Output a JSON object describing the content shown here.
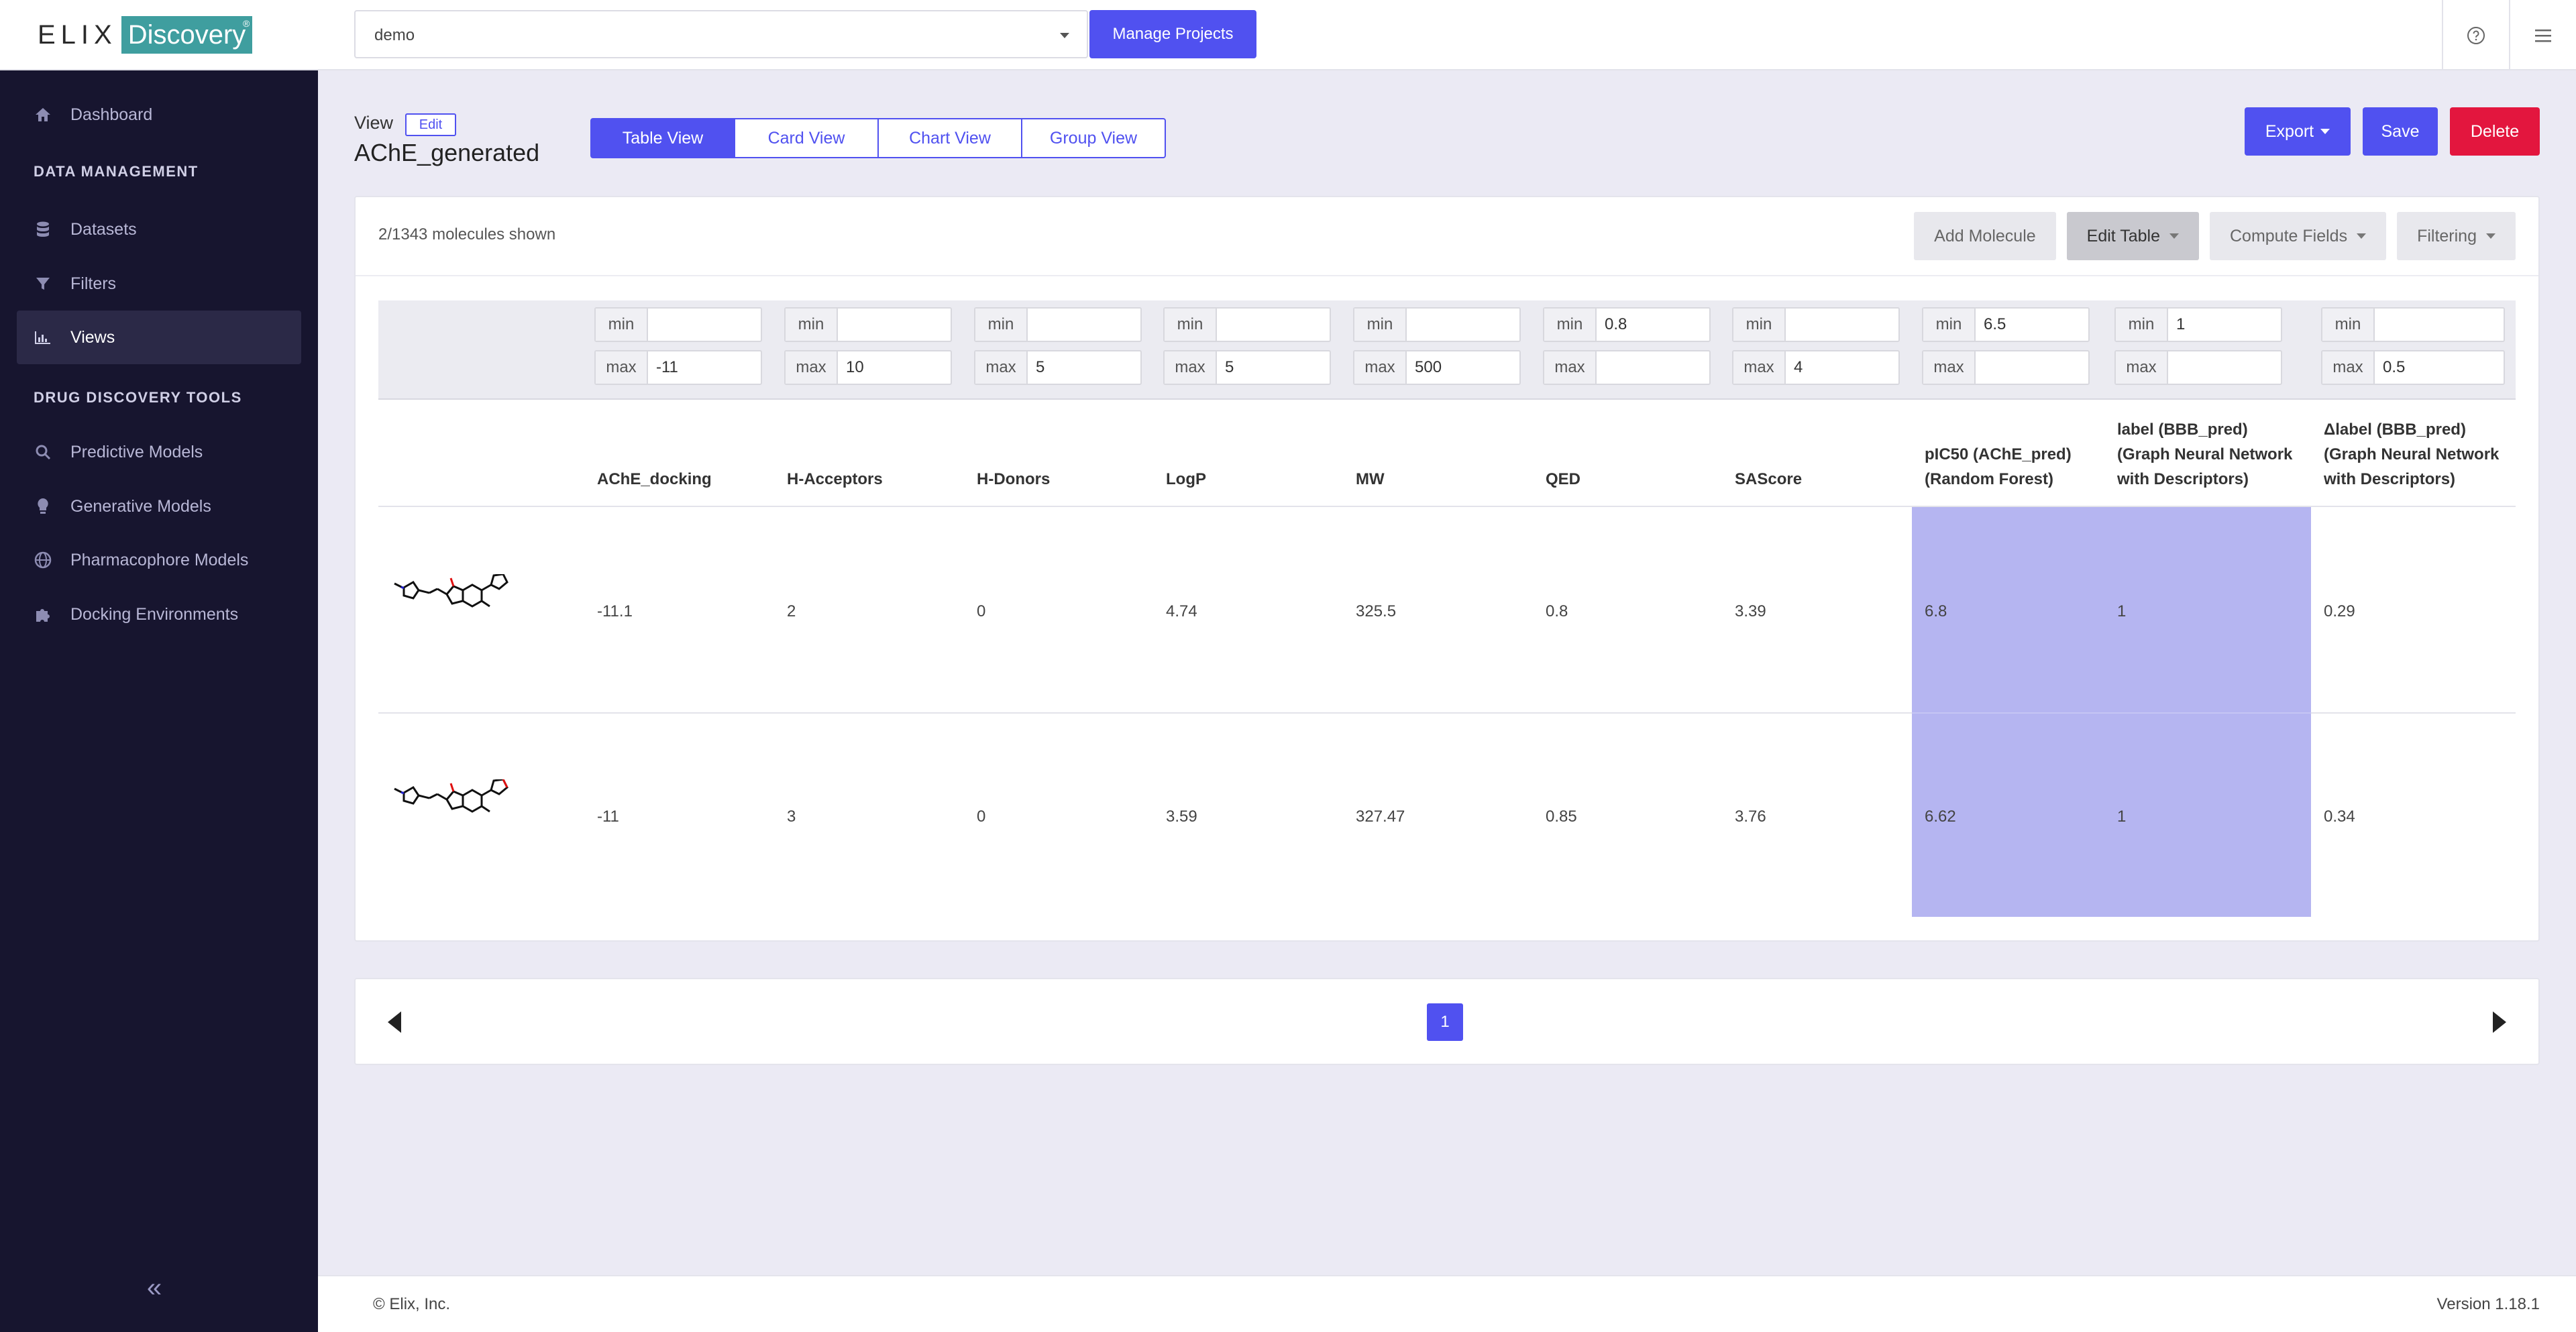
{
  "brand": {
    "part1": "ELIX",
    "part2": "Discovery",
    "mark": "®"
  },
  "project": {
    "selected": "demo",
    "manage_label": "Manage Projects"
  },
  "sidebar": {
    "items": [
      {
        "label": "Dashboard",
        "icon": "home-icon"
      },
      {
        "label": "Datasets",
        "icon": "database-icon"
      },
      {
        "label": "Filters",
        "icon": "filter-icon"
      },
      {
        "label": "Views",
        "icon": "chart-icon"
      },
      {
        "label": "Predictive Models",
        "icon": "search-icon"
      },
      {
        "label": "Generative Models",
        "icon": "lightbulb-icon"
      },
      {
        "label": "Pharmacophore Models",
        "icon": "globe-icon"
      },
      {
        "label": "Docking Environments",
        "icon": "puzzle-icon"
      }
    ],
    "headings": [
      "DATA MANAGEMENT",
      "DRUG DISCOVERY TOOLS"
    ],
    "collapse_label": "«"
  },
  "view": {
    "label": "View",
    "edit_label": "Edit",
    "title": "AChE_generated"
  },
  "tabs": [
    "Table View",
    "Card View",
    "Chart View",
    "Group View"
  ],
  "actions": {
    "export": "Export",
    "save": "Save",
    "delete": "Delete"
  },
  "table_header": {
    "count": "2/1343 molecules shown",
    "buttons": [
      "Add Molecule",
      "Edit Table",
      "Compute Fields",
      "Filtering"
    ]
  },
  "filters": {
    "min_label": "min",
    "max_label": "max",
    "columns": [
      {
        "min": "",
        "max": "-11"
      },
      {
        "min": "",
        "max": "10"
      },
      {
        "min": "",
        "max": "5"
      },
      {
        "min": "",
        "max": "5"
      },
      {
        "min": "",
        "max": "500"
      },
      {
        "min": "0.8",
        "max": ""
      },
      {
        "min": "",
        "max": "4"
      },
      {
        "min": "6.5",
        "max": ""
      },
      {
        "min": "1",
        "max": ""
      },
      {
        "min": "",
        "max": "0.5"
      }
    ]
  },
  "columns": [
    [
      "AChE_docking"
    ],
    [
      "H-Acceptors"
    ],
    [
      "H-Donors"
    ],
    [
      "LogP"
    ],
    [
      "MW"
    ],
    [
      "QED"
    ],
    [
      "SAScore"
    ],
    [
      "pIC50 (AChE_pred)",
      "(Random Forest)"
    ],
    [
      "label (BBB_pred)",
      "(Graph Neural Network",
      "with Descriptors)"
    ],
    [
      "Δlabel (BBB_pred)",
      "(Graph Neural Network",
      "with Descriptors)"
    ]
  ],
  "rows": [
    [
      "-11.1",
      "2",
      "0",
      "4.74",
      "325.5",
      "0.8",
      "3.39",
      "6.8",
      "1",
      "0.29"
    ],
    [
      "-11",
      "3",
      "0",
      "3.59",
      "327.47",
      "0.85",
      "3.76",
      "6.62",
      "1",
      "0.34"
    ]
  ],
  "pagination": {
    "current": "1"
  },
  "footer": {
    "copyright": "© Elix, Inc.",
    "version": "Version 1.18.1"
  },
  "colors": {
    "accent": "#5051f0",
    "danger": "#e3163e",
    "sidebar": "#17152f",
    "highlight": "#b5b5f1",
    "brand": "#3f9e9f"
  }
}
